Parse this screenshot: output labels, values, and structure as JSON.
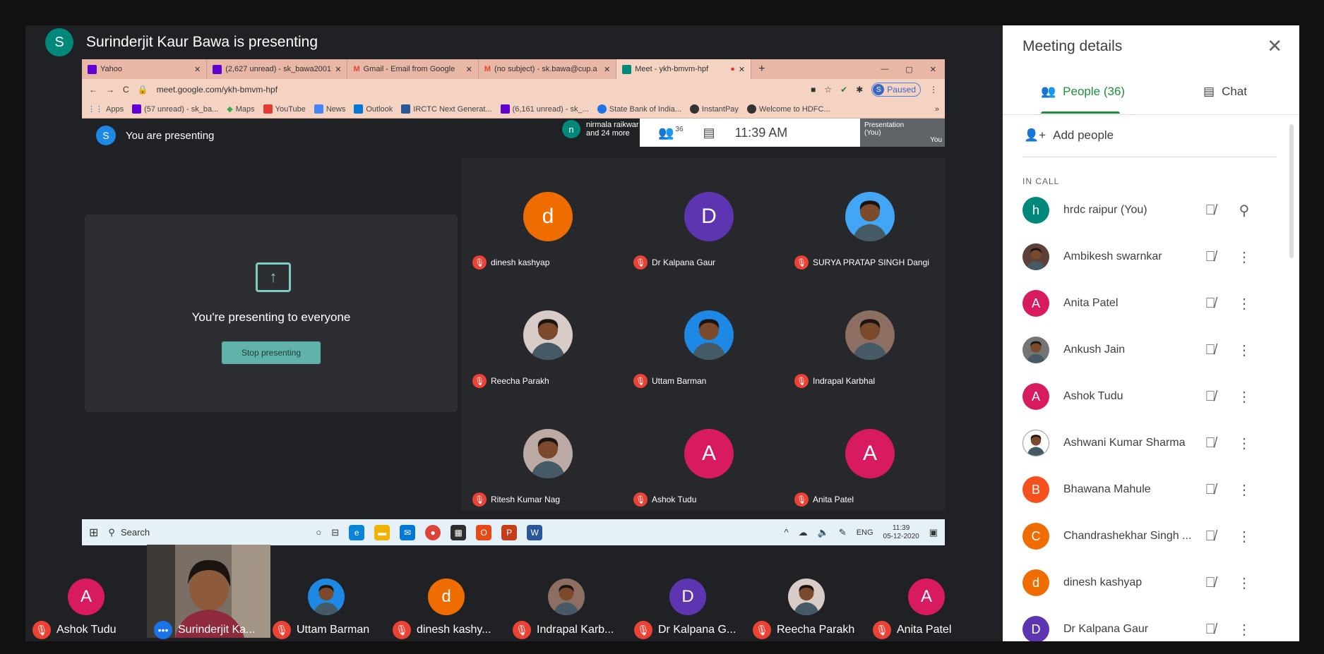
{
  "presenter_banner": {
    "initial": "S",
    "text": "Surinderjit Kaur Bawa is presenting"
  },
  "browser": {
    "tabs": [
      {
        "label": "Yahoo",
        "color": "#6001d2"
      },
      {
        "label": "(2,627 unread) - sk_bawa2001",
        "color": "#6001d2"
      },
      {
        "label": "Gmail - Email from Google",
        "color": "#ea4335"
      },
      {
        "label": "(no subject) - sk.bawa@cup.a",
        "color": "#ea4335"
      },
      {
        "label": "Meet - ykh-bmvm-hpf",
        "color": "#00897b"
      }
    ],
    "url": "meet.google.com/ykh-bmvm-hpf",
    "profile_status": "Paused",
    "bookmarks": [
      "Apps",
      "(57 unread) - sk_ba...",
      "Maps",
      "YouTube",
      "News",
      "Outlook",
      "IRCTC Next Generat...",
      "(6,161 unread) - sk_...",
      "State Bank of India...",
      "InstantPay",
      "Welcome to HDFC..."
    ]
  },
  "inner_meet": {
    "you_presenting": "You are presenting",
    "you_initial": "S",
    "other_initial": "n",
    "other_line1": "nirmala raikwar",
    "other_line2": "and 24 more",
    "participants_count": "36",
    "time": "11:39 AM",
    "presentation_label": "Presentation",
    "presentation_you": "(You)",
    "you_label": "You",
    "card_title": "You're presenting to everyone",
    "stop_button": "Stop presenting",
    "grid": [
      {
        "name": "dinesh kashyap",
        "initial": "d",
        "color": "#ef6c00",
        "photo": false
      },
      {
        "name": "Dr Kalpana Gaur",
        "initial": "D",
        "color": "#5e35b1",
        "photo": false
      },
      {
        "name": "SURYA PRATAP SINGH Dangi",
        "initial": "",
        "color": "#42a5f5",
        "photo": true
      },
      {
        "name": "Reecha Parakh",
        "initial": "",
        "color": "#d7ccc8",
        "photo": true
      },
      {
        "name": "Uttam Barman",
        "initial": "",
        "color": "#1e88e5",
        "photo": true
      },
      {
        "name": "Indrapal Karbhal",
        "initial": "",
        "color": "#8d6e63",
        "photo": true
      },
      {
        "name": "Ritesh Kumar Nag",
        "initial": "",
        "color": "#bcaaa4",
        "photo": true
      },
      {
        "name": "Ashok Tudu",
        "initial": "A",
        "color": "#d81b60",
        "photo": false
      },
      {
        "name": "Anita Patel",
        "initial": "A",
        "color": "#d81b60",
        "photo": false
      }
    ]
  },
  "taskbar": {
    "search": "Search",
    "lang": "ENG",
    "time": "11:39",
    "date": "05-12-2020"
  },
  "strip": [
    {
      "name": "Ashok Tudu",
      "initial": "A",
      "color": "#d81b60",
      "photo": false
    },
    {
      "name": "Surinderjit Ka...",
      "initial": "",
      "color": "#6b6259",
      "photo": false
    },
    {
      "name": "Uttam Barman",
      "initial": "",
      "color": "#1e88e5",
      "photo": true
    },
    {
      "name": "dinesh kashy...",
      "initial": "d",
      "color": "#ef6c00",
      "photo": false
    },
    {
      "name": "Indrapal Karb...",
      "initial": "",
      "color": "#8d6e63",
      "photo": true
    },
    {
      "name": "Dr Kalpana G...",
      "initial": "D",
      "color": "#5e35b1",
      "photo": false
    },
    {
      "name": "Reecha Parakh",
      "initial": "",
      "color": "#d7ccc8",
      "photo": true
    },
    {
      "name": "Anita Patel",
      "initial": "A",
      "color": "#d81b60",
      "photo": false
    }
  ],
  "panel": {
    "title": "Meeting details",
    "people_tab": "People (36)",
    "chat_tab": "Chat",
    "add_people": "Add people",
    "in_call": "IN CALL",
    "people": [
      {
        "name": "hrdc raipur (You)",
        "initial": "h",
        "color": "#00897b",
        "photo": false,
        "action": "pin"
      },
      {
        "name": "Ambikesh swarnkar",
        "initial": "",
        "color": "#5d4037",
        "photo": true,
        "action": "more"
      },
      {
        "name": "Anita Patel",
        "initial": "A",
        "color": "#d81b60",
        "photo": false,
        "action": "more"
      },
      {
        "name": "Ankush Jain",
        "initial": "",
        "color": "#757575",
        "photo": true,
        "action": "more"
      },
      {
        "name": "Ashok Tudu",
        "initial": "A",
        "color": "#d81b60",
        "photo": false,
        "action": "more"
      },
      {
        "name": "Ashwani Kumar Sharma",
        "initial": "",
        "color": "#ffffff",
        "photo": true,
        "action": "more"
      },
      {
        "name": "Bhawana Mahule",
        "initial": "B",
        "color": "#f4511e",
        "photo": false,
        "action": "more"
      },
      {
        "name": "Chandrashekhar Singh ...",
        "initial": "C",
        "color": "#ef6c00",
        "photo": false,
        "action": "more"
      },
      {
        "name": "dinesh kashyap",
        "initial": "d",
        "color": "#ef6c00",
        "photo": false,
        "action": "more"
      },
      {
        "name": "Dr Kalpana Gaur",
        "initial": "D",
        "color": "#5e35b1",
        "photo": false,
        "action": "more"
      }
    ]
  }
}
